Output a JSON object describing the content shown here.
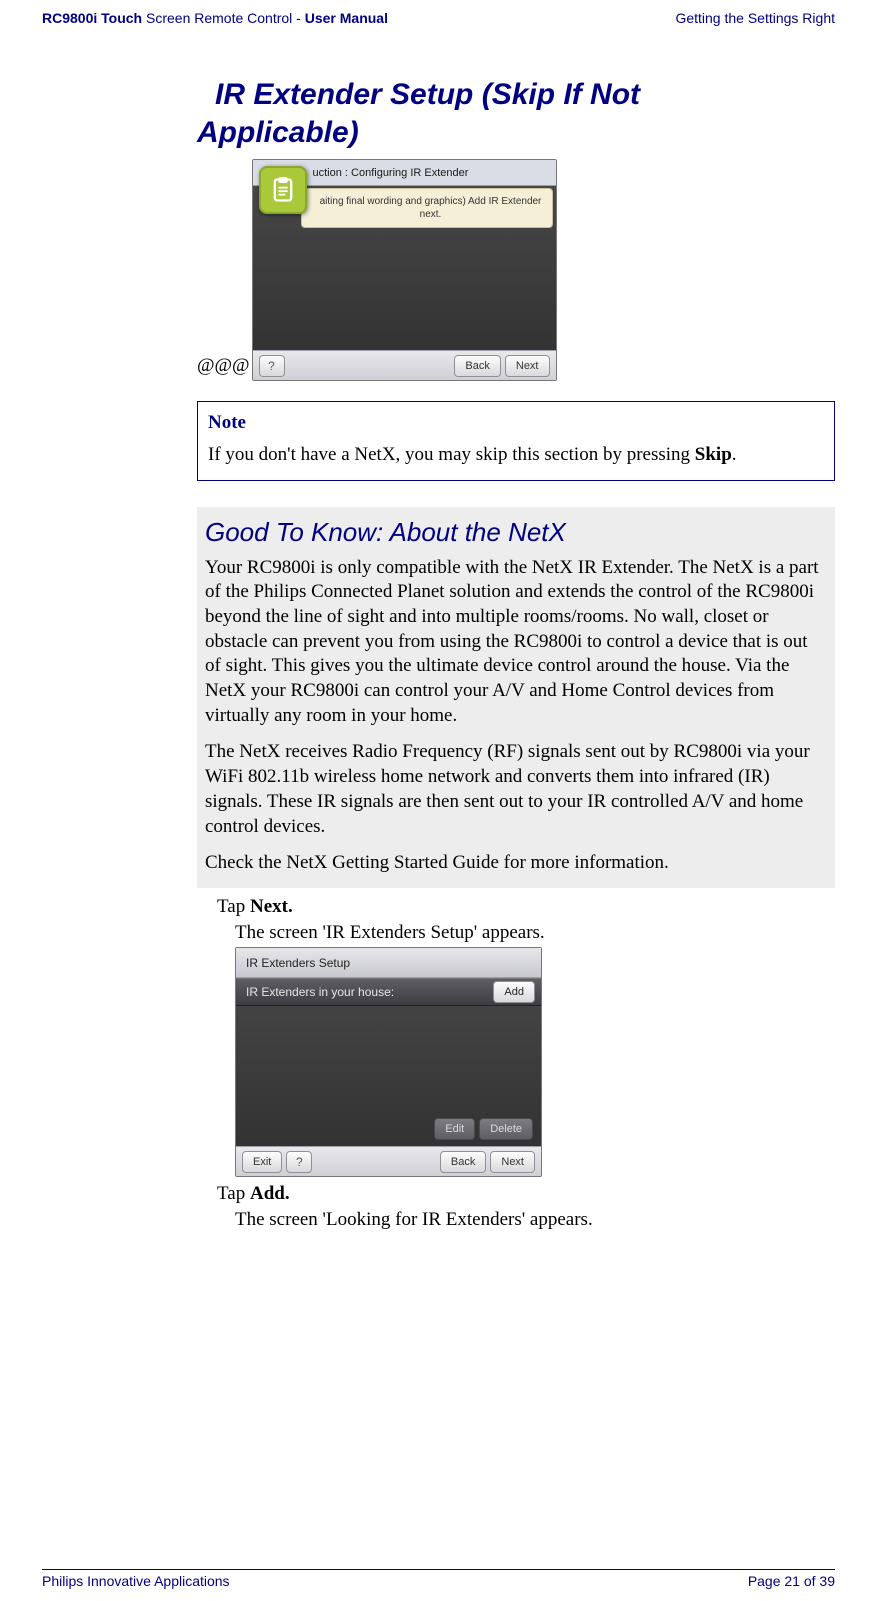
{
  "header": {
    "product": "RC9800i Touch",
    "product_tail": " Screen Remote Control - ",
    "doc": "User Manual",
    "right": "Getting the Settings Right"
  },
  "title_line1_indent": " IR Extender Setup (Skip If Not",
  "title_line2": "Applicable)",
  "fig1": {
    "at": "@@@",
    "titlebar": "uction : Configuring IR Extender",
    "banner": "aiting final wording and graphics) Add IR Extender next.",
    "help": "?",
    "back": "Back",
    "next": "Next"
  },
  "note": {
    "tag": "Note",
    "text_pre": "If you don't have a NetX, you may skip this section by pressing ",
    "text_bold": "Skip",
    "text_post": "."
  },
  "gtk": {
    "heading": "Good To Know: About the NetX",
    "p1": "Your RC9800i is only compatible with the NetX IR Extender. The NetX is a part of the Philips Connected Planet solution and extends the control of the RC9800i beyond the line of sight and into multiple rooms/rooms. No wall, closet or obstacle can prevent you from using the RC9800i to control a device that is out of sight. This gives you the ultimate device control around the house. Via the NetX your RC9800i can control your A/V and Home Control devices from virtually any room in your home.",
    "p2": "The NetX receives Radio Frequency (RF) signals sent out by RC9800i via your WiFi 802.11b wireless home network and converts them into infrared (IR) signals. These IR signals are then sent out to your IR controlled A/V and home control devices.",
    "p3": "Check the NetX Getting Started Guide for more information."
  },
  "steps": {
    "s1_pre": "Tap ",
    "s1_bold": "Next.",
    "s1_sub": "The screen 'IR Extenders Setup' appears.",
    "s2_pre": "Tap ",
    "s2_bold": "Add.",
    "s2_sub": "The screen 'Looking for IR Extenders' appears."
  },
  "fig2": {
    "title": "IR Extenders Setup",
    "listhdr": "IR Extenders in your house:",
    "add": "Add",
    "edit": "Edit",
    "delete": "Delete",
    "exit": "Exit",
    "help": "?",
    "back": "Back",
    "next": "Next"
  },
  "footer": {
    "left": "Philips Innovative Applications",
    "right": "Page 21 of 39"
  }
}
